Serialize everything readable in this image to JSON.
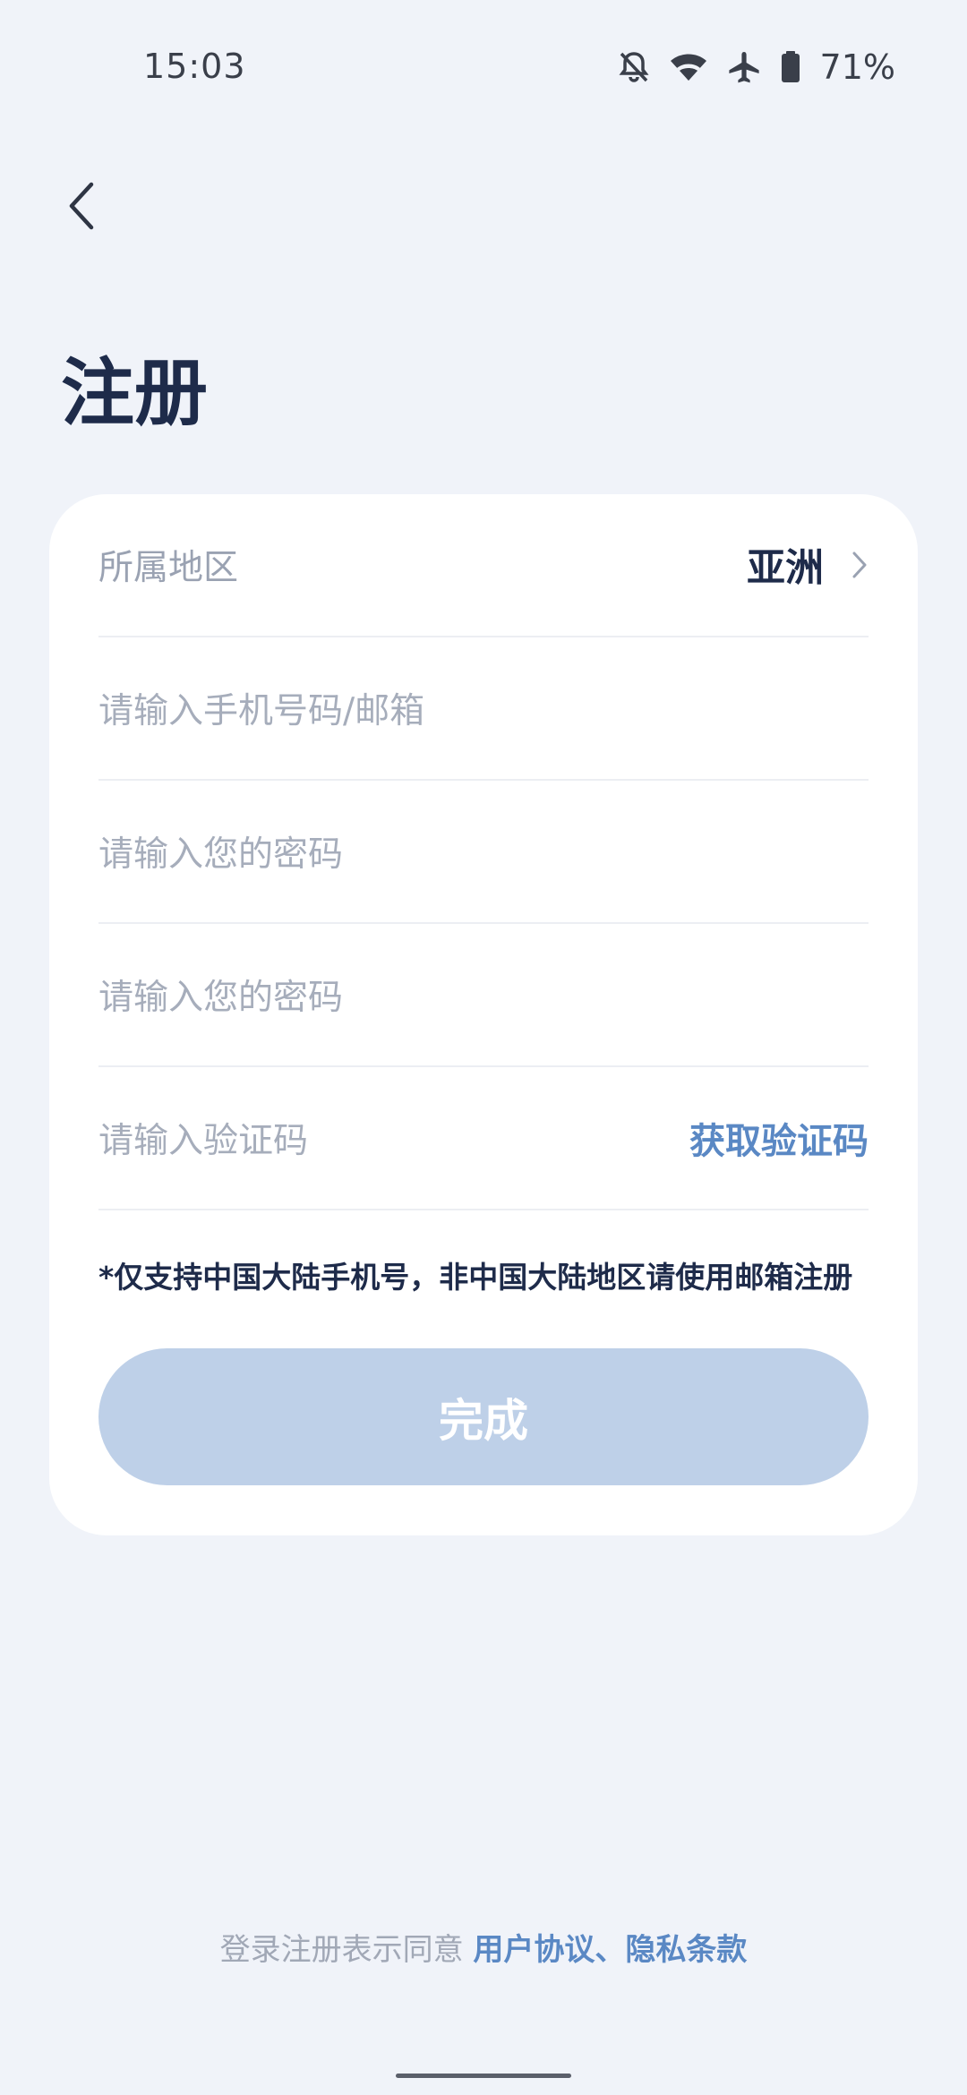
{
  "status_bar": {
    "time": "15:03",
    "battery": "71%",
    "icons": [
      "bell-off-icon",
      "wifi-icon",
      "airplane-icon",
      "battery-icon"
    ]
  },
  "header": {
    "title": "注册"
  },
  "form": {
    "region_label": "所属地区",
    "region_value": "亚洲",
    "phone_placeholder": "请输入手机号码/邮箱",
    "password_placeholder": "请输入您的密码",
    "password_confirm_placeholder": "请输入您的密码",
    "code_placeholder": "请输入验证码",
    "get_code_label": "获取验证码",
    "notice": "*仅支持中国大陆手机号，非中国大陆地区请使用邮箱注册",
    "submit_label": "完成"
  },
  "footer": {
    "agreement_prefix": "登录注册表示同意 ",
    "terms_link": "用户协议",
    "separator": "、",
    "privacy_link": "隐私条款"
  },
  "colors": {
    "background": "#f0f3f9",
    "accent": "#5a88c4",
    "button_disabled": "#bed0e8",
    "title": "#1e2b4a"
  }
}
